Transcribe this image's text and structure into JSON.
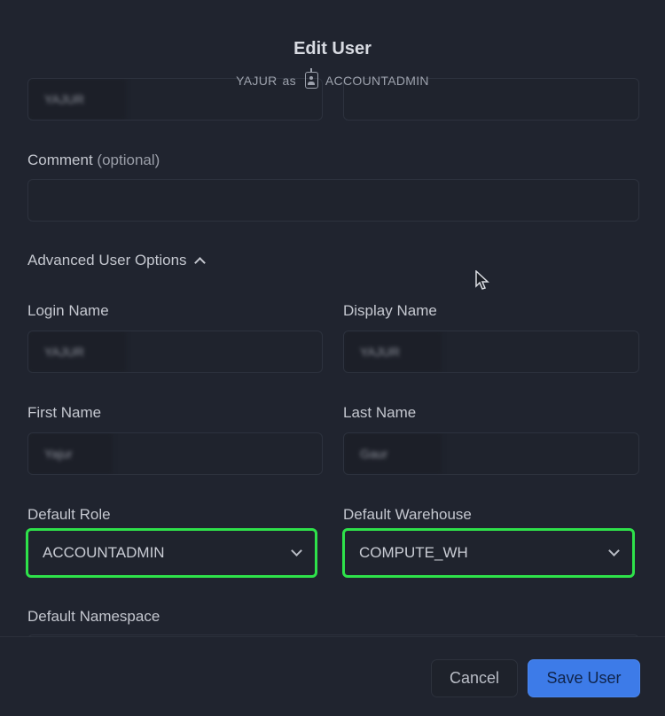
{
  "dialog": {
    "title": "Edit User",
    "subtitle": {
      "user": "YAJUR",
      "as_text": "as",
      "role_icon": "role-badge-icon",
      "role": "ACCOUNTADMIN"
    }
  },
  "form": {
    "top_row": {
      "left_value": "YAJUR",
      "right_value": ""
    },
    "comment": {
      "label": "Comment",
      "optional": "(optional)",
      "value": ""
    },
    "advanced": {
      "label": "Advanced User Options",
      "icon": "chevron-up-icon",
      "expanded": true
    },
    "login_name": {
      "label": "Login Name",
      "value": "YAJUR"
    },
    "display_name": {
      "label": "Display Name",
      "value": "YAJUR"
    },
    "first_name": {
      "label": "First Name",
      "value": "Yajur"
    },
    "last_name": {
      "label": "Last Name",
      "value": "Gaur"
    },
    "default_role": {
      "label": "Default Role",
      "value": "ACCOUNTADMIN",
      "icon": "chevron-down-icon"
    },
    "default_warehouse": {
      "label": "Default Warehouse",
      "value": "COMPUTE_WH",
      "icon": "chevron-down-icon"
    },
    "default_namespace": {
      "label": "Default Namespace",
      "value": ""
    }
  },
  "footer": {
    "cancel_label": "Cancel",
    "save_label": "Save User"
  },
  "colors": {
    "background": "#20242f",
    "highlight": "#2ee24a",
    "primary": "#3d7be8"
  }
}
